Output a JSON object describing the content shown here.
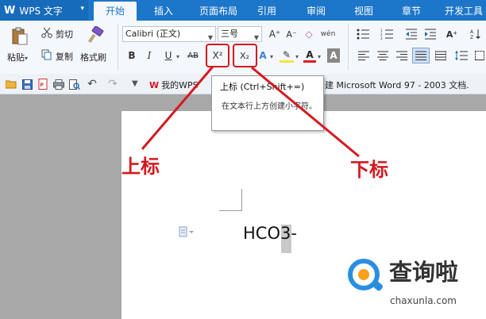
{
  "app": {
    "logo": "W",
    "title": "WPS 文字",
    "dropdown": "▾"
  },
  "tabs": [
    {
      "label": "开始"
    },
    {
      "label": "插入"
    },
    {
      "label": "页面布局"
    },
    {
      "label": "引用"
    },
    {
      "label": "审阅"
    },
    {
      "label": "视图"
    },
    {
      "label": "章节"
    },
    {
      "label": "开发工具"
    }
  ],
  "clipboard": {
    "paste": "粘贴",
    "paste_arrow": "▾",
    "cut": "剪切",
    "copy": "复制",
    "format_painter": "格式刷"
  },
  "font": {
    "name": "Calibri (正文)",
    "size": "三号",
    "grow": "A⁺",
    "shrink": "A⁻",
    "clear": "◇",
    "phonetic": "wén",
    "bold": "B",
    "italic": "I",
    "underline": "U",
    "strike": "AB",
    "superscript": "X²",
    "subscript": "X₂",
    "effects": "A",
    "highlight": "✎",
    "font_color": "A",
    "shading": "A"
  },
  "quickbar": {
    "doc_tab": "我的WPS",
    "doc_title": "新建 Microsoft Word 97 - 2003 文档."
  },
  "tooltip": {
    "title": "上标 (Ctrl+Shift+=)",
    "desc": "在文本行上方创建小字符。"
  },
  "annotations": {
    "superscript": "上标",
    "subscript": "下标"
  },
  "document": {
    "text": "HCO3-"
  },
  "watermark": {
    "name": "查询啦",
    "url": "chaxunla.com"
  },
  "colors": {
    "accent": "#1c76c9",
    "annotation": "#d4191f",
    "watermark": "#2a8ee0"
  }
}
